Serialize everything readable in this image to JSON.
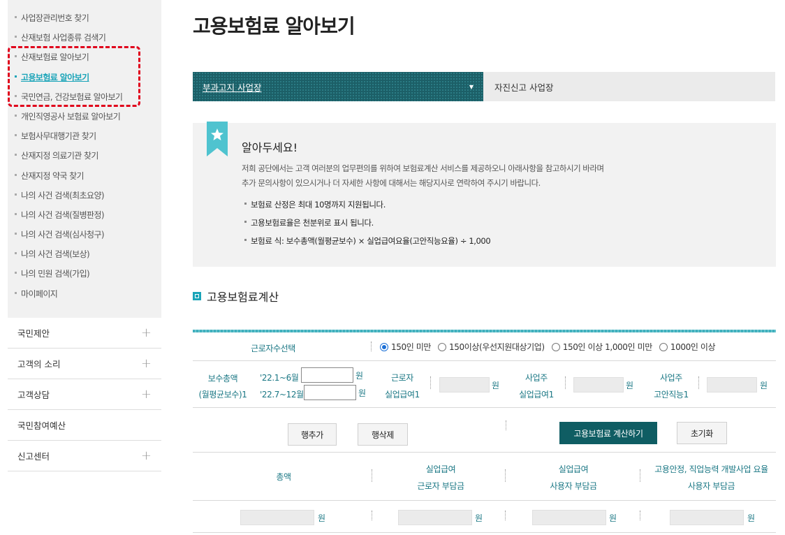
{
  "sidebar": {
    "sub_items": [
      {
        "label": "사업장관리번호 찾기"
      },
      {
        "label": "산재보험 사업종류 검색기"
      },
      {
        "label": "산재보험료 알아보기"
      },
      {
        "label": "고용보험료 알아보기"
      },
      {
        "label": "국민연금, 건강보험료 알아보기"
      },
      {
        "label": "개인직영공사 보험료 알아보기"
      },
      {
        "label": "보험사무대행기관 찾기"
      },
      {
        "label": "산재지정 의료기관 찾기"
      },
      {
        "label": "산재지정 약국 찾기"
      },
      {
        "label": "나의 사건 검색(최초요양)"
      },
      {
        "label": "나의 사건 검색(질병판정)"
      },
      {
        "label": "나의 사건 검색(심사청구)"
      },
      {
        "label": "나의 사건 검색(보상)"
      },
      {
        "label": "나의 민원 검색(가입)"
      },
      {
        "label": "마이페이지"
      }
    ],
    "active_index": 3,
    "main_items": [
      {
        "label": "국민제안",
        "expand": "+"
      },
      {
        "label": "고객의 소리",
        "expand": "+"
      },
      {
        "label": "고객상담",
        "expand": "+"
      },
      {
        "label": "국민참여예산",
        "expand": ""
      },
      {
        "label": "신고센터",
        "expand": "+"
      }
    ]
  },
  "page": {
    "title": "고용보험료 알아보기"
  },
  "tabs": {
    "active": "부과고지 사업장",
    "active_arrow": "▼",
    "inactive": "자진신고 사업장"
  },
  "notice": {
    "title": "알아두세요!",
    "desc_line1": "저희 공단에서는 고객 여러분의 업무편의를 위하여 보험료계산 서비스를 제공하오니 아래사항을 참고하시기 바라며",
    "desc_line2": "추가 문의사항이 있으시거나 더 자세한 사항에 대해서는 해당지사로 연락하여 주시기 바랍니다.",
    "items": [
      "보험료 산정은 최대 10명까지 지원됩니다.",
      "고용보험료율은 천분위로 표시 됩니다.",
      "보험료 식: 보수총액(월평균보수) × 실업급여요율(고안직능요율) ÷ 1,000"
    ]
  },
  "calc": {
    "section_title": "고용보험료계산",
    "worker_count_label": "근로자수선택",
    "options": [
      "150인 미만",
      "150이상(우선지원대상기업)",
      "150인 이상 1,000인 미만",
      "1000인 이상"
    ],
    "selected_option": 0,
    "pay_label_1": "보수총액",
    "pay_label_2": "(월평균보수)1",
    "period_1": "'22.1~6월",
    "period_2": "'22.7~12월",
    "won": "원",
    "worker_rate_1": "근로자",
    "worker_rate_2": "실업급여1",
    "employer_rate_1": "사업주",
    "employer_rate_2": "실업급여1",
    "employer_train_1": "사업주",
    "employer_train_2": "고안직능1",
    "btn_add_row": "행추가",
    "btn_del_row": "행삭제",
    "btn_calculate": "고용보험료 계산하기",
    "btn_reset": "초기화",
    "result_total": "총액",
    "result_worker_1": "실업급여",
    "result_worker_2": "근로자 부담금",
    "result_employer_1": "실업급여",
    "result_employer_2": "사용자 부담금",
    "result_train_1": "고용안정, 직업능력 개발사업 요율",
    "result_train_2": "사용자 부담금"
  }
}
